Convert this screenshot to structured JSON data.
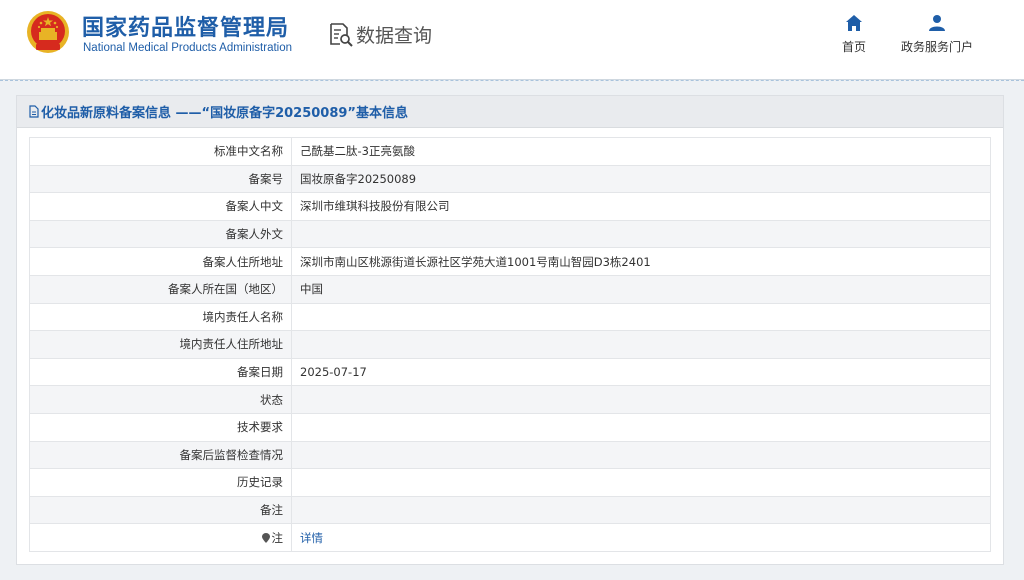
{
  "header": {
    "title_cn": "国家药品监督管理局",
    "title_en": "National Medical Products Administration",
    "db_query_label": "数据查询",
    "nav": {
      "home_label": "首页",
      "portal_label": "政务服务门户"
    }
  },
  "panel": {
    "title": "化妆品新原料备案信息 ——“国妆原备字20250089”基本信息"
  },
  "rows": [
    {
      "key": "标准中文名称",
      "value": "己酰基二肽-3正亮氨酸"
    },
    {
      "key": "备案号",
      "value": "国妆原备字20250089"
    },
    {
      "key": "备案人中文",
      "value": "深圳市维琪科技股份有限公司"
    },
    {
      "key": "备案人外文",
      "value": ""
    },
    {
      "key": "备案人住所地址",
      "value": "深圳市南山区桃源街道长源社区学苑大道1001号南山智园D3栋2401"
    },
    {
      "key": "备案人所在国（地区）",
      "value": "中国"
    },
    {
      "key": "境内责任人名称",
      "value": ""
    },
    {
      "key": "境内责任人住所地址",
      "value": ""
    },
    {
      "key": "备案日期",
      "value": "2025-07-17"
    },
    {
      "key": "状态",
      "value": ""
    },
    {
      "key": "技术要求",
      "value": ""
    },
    {
      "key": "备案后监督检查情况",
      "value": ""
    },
    {
      "key": "历史记录",
      "value": ""
    },
    {
      "key": "备注",
      "value": ""
    }
  ],
  "note_row": {
    "key": "注",
    "link_label": "详情"
  },
  "colors": {
    "brand_blue": "#1f5ea8",
    "emblem_red": "#d62a1e",
    "emblem_gold": "#e8b325"
  }
}
